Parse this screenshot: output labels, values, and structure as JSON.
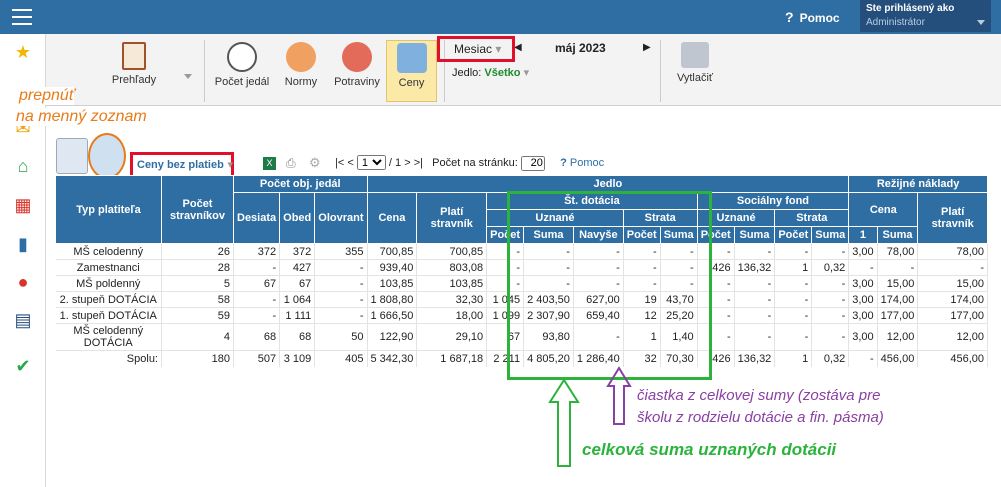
{
  "topbar": {
    "help": "Pomoc",
    "user_label": "Ste prihlásený ako",
    "user_name": "Administrátor"
  },
  "toolbar": {
    "prehlady": "Prehľady",
    "pocet_jedal": "Počet jedál",
    "normy": "Normy",
    "potraviny": "Potraviny",
    "ceny": "Ceny",
    "period": "Mesiac",
    "month": "máj 2023",
    "jedlo_label": "Jedlo:",
    "jedlo_value": "Všetko",
    "tlacit": "Vytlačiť"
  },
  "notes": {
    "prepnut_1": "prepnúť",
    "prepnut_2": "na menný zoznam",
    "ciastka_1": "čiastka z celkovej sumy (zostáva pre",
    "ciastka_2": "školu z rodzielu dotácie a fin. pásma)",
    "celkova": "celková suma uznaných dotácii"
  },
  "list": {
    "filter": "Ceny bez platieb",
    "pager_first": "|<",
    "pager_prev": "<",
    "page": "1",
    "of": "/ 1",
    "pager_next": ">",
    "pager_last": ">|",
    "per_page_label": "Počet na stránku:",
    "per_page": "20",
    "help": "Pomoc"
  },
  "table": {
    "h_typ": "Typ platiteľa",
    "h_pocet": "Počet stravníkov",
    "h_obj": "Počet obj. jedál",
    "h_jedlo": "Jedlo",
    "h_rezie": "Režijné náklady",
    "h_desiata": "Desiata",
    "h_obed": "Obed",
    "h_olovrant": "Olovrant",
    "h_cena": "Cena",
    "h_plati": "Platí stravník",
    "h_dotacia": "Št. dotácia",
    "h_uznane": "Uznané",
    "h_strata": "Strata",
    "h_socfond": "Sociálny fond",
    "h_uznane2": "Uznané",
    "h_strata2": "Strata",
    "h_cena2": "Cena",
    "h_plati2": "Platí stravník",
    "h_u_pocet": "Počet",
    "h_u_suma": "Suma",
    "h_u_navyse": "Navyše",
    "h_s_pocet": "Počet",
    "h_s_suma": "Suma",
    "h_sf_u_pocet": "Počet",
    "h_sf_u_suma": "Suma",
    "h_sf_s_pocet": "Počet",
    "h_sf_s_suma": "Suma",
    "h_r_1": "1",
    "h_r_suma": "Suma",
    "rows": [
      [
        "MŠ celodenný",
        "26",
        "372",
        "372",
        "355",
        "700,85",
        "700,85",
        "-",
        "-",
        "-",
        "-",
        "-",
        "-",
        "-",
        "-",
        "-",
        "3,00",
        "78,00",
        "78,00"
      ],
      [
        "Zamestnanci",
        "28",
        "-",
        "427",
        "-",
        "939,40",
        "803,08",
        "-",
        "-",
        "-",
        "-",
        "-",
        "426",
        "136,32",
        "1",
        "0,32",
        "-",
        "-",
        "-"
      ],
      [
        "MŠ poldenný",
        "5",
        "67",
        "67",
        "-",
        "103,85",
        "103,85",
        "-",
        "-",
        "-",
        "-",
        "-",
        "-",
        "-",
        "-",
        "-",
        "3,00",
        "15,00",
        "15,00"
      ],
      [
        "2. stupeň DOTÁCIA",
        "58",
        "-",
        "1 064",
        "-",
        "1 808,80",
        "32,30",
        "1 045",
        "2 403,50",
        "627,00",
        "19",
        "43,70",
        "-",
        "-",
        "-",
        "-",
        "3,00",
        "174,00",
        "174,00"
      ],
      [
        "1. stupeň DOTÁCIA",
        "59",
        "-",
        "1 111",
        "-",
        "1 666,50",
        "18,00",
        "1 099",
        "2 307,90",
        "659,40",
        "12",
        "25,20",
        "-",
        "-",
        "-",
        "-",
        "3,00",
        "177,00",
        "177,00"
      ],
      [
        "MŠ celodenný DOTÁCIA",
        "4",
        "68",
        "68",
        "50",
        "122,90",
        "29,10",
        "67",
        "93,80",
        "-",
        "1",
        "1,40",
        "-",
        "-",
        "-",
        "-",
        "3,00",
        "12,00",
        "12,00"
      ],
      [
        "Spolu:",
        "180",
        "507",
        "3 109",
        "405",
        "5 342,30",
        "1 687,18",
        "2 211",
        "4 805,20",
        "1 286,40",
        "32",
        "70,30",
        "426",
        "136,32",
        "1",
        "0,32",
        "-",
        "456,00",
        "456,00"
      ]
    ]
  },
  "colors": {
    "header": "#2f6ea3",
    "red": "#e0102a",
    "green": "#2bb33c",
    "purple": "#8a3fa3",
    "orange": "#e87b18"
  }
}
